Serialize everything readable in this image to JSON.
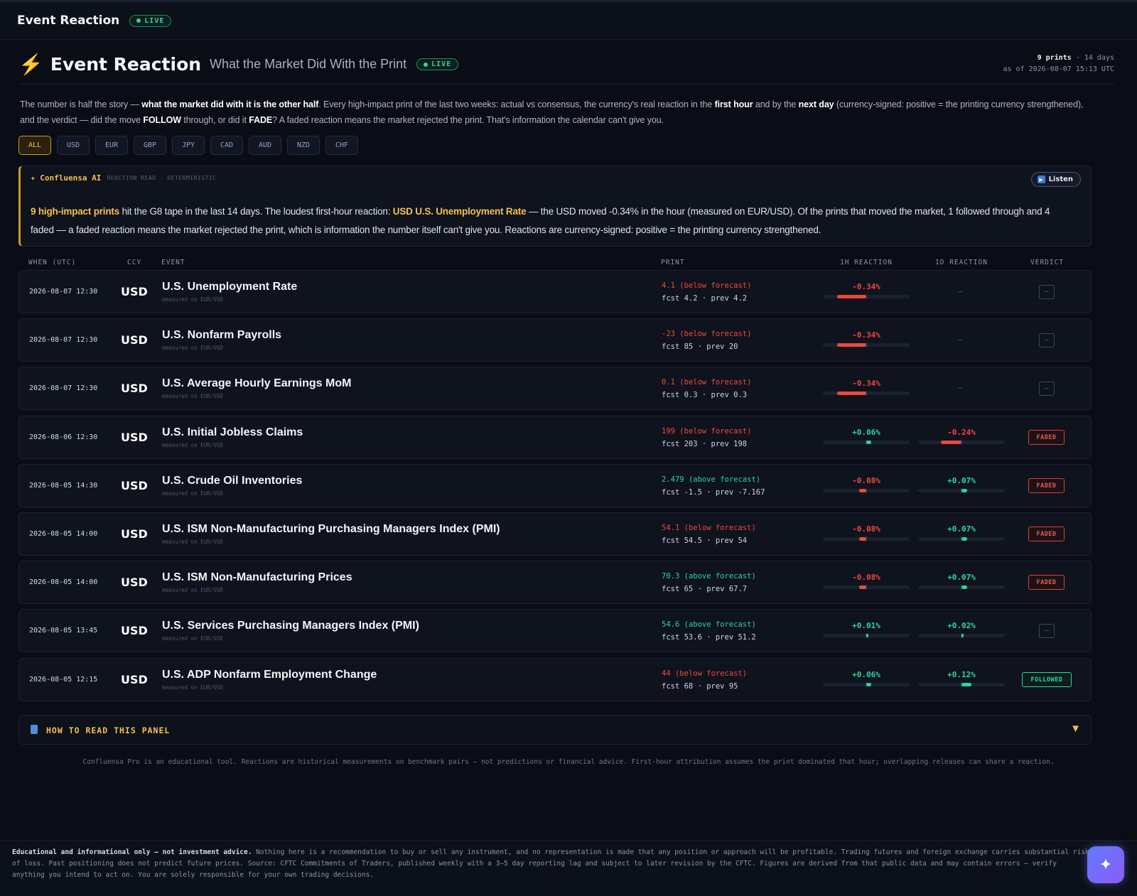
{
  "topbar": {
    "title": "Event Reaction",
    "live": "LIVE"
  },
  "header": {
    "title": "Event Reaction",
    "subtitle": "What the Market Did With the Print",
    "live": "LIVE",
    "meta_count": "9 prints",
    "meta_days": "· 14 days",
    "meta_asof": "as of 2026-08-07 15:13 UTC"
  },
  "intro": {
    "t1": "The number is half the story — ",
    "b1": "what the market did with it is the other half",
    "t2": ". Every high-impact print of the last two weeks: actual vs consensus, the currency's real reaction in the ",
    "b2": "first hour",
    "t3": " and by the ",
    "b3": "next day",
    "t4": " (currency-signed: positive = the printing currency strengthened), and the verdict — did the move ",
    "b4": "FOLLOW",
    "t5": " through, or did it ",
    "b5": "FADE",
    "t6": "? A faded reaction means the market rejected the print. That's information the calendar can't give you."
  },
  "filters": [
    "ALL",
    "USD",
    "EUR",
    "GBP",
    "JPY",
    "CAD",
    "AUD",
    "NZD",
    "CHF"
  ],
  "ai": {
    "brand": "✦ Confluensa AI",
    "tag": "REACTION READ · DETERMINISTIC",
    "listen": "Listen",
    "h1": "9 high-impact prints",
    "t1": " hit the G8 tape in the last 14 days. The loudest first-hour reaction: ",
    "h2": "USD U.S. Unemployment Rate",
    "t2": " — the USD moved -0.34% in the hour (measured on EUR/USD). Of the prints that moved the market, 1 followed through and 4 faded — a faded reaction means the market rejected the print, which is information the number itself can't give you. Reactions are currency-signed: positive = the printing currency strengthened."
  },
  "columns": {
    "when": "WHEN (UTC)",
    "ccy": "CCY",
    "event": "EVENT",
    "print": "PRINT",
    "r1h": "1H REACTION",
    "r1d": "1D REACTION",
    "verdict": "VERDICT"
  },
  "rows": [
    {
      "when": "2026-08-07 12:30",
      "ccy": "USD",
      "event": "U.S. Unemployment Rate",
      "measured": "measured on EUR/USD",
      "actual": "4.1",
      "dir": "(below forecast)",
      "dir_sign": "neg",
      "fcst": "fcst 4.2 · prev 4.2",
      "r1h": "-0.34%",
      "r1h_v": -0.34,
      "r1d": "—",
      "r1d_v": null,
      "verdict": "—",
      "verdict_type": "none"
    },
    {
      "when": "2026-08-07 12:30",
      "ccy": "USD",
      "event": "U.S. Nonfarm Payrolls",
      "measured": "measured on EUR/USD",
      "actual": "-23",
      "dir": "(below forecast)",
      "dir_sign": "neg",
      "fcst": "fcst 85 · prev 20",
      "r1h": "-0.34%",
      "r1h_v": -0.34,
      "r1d": "—",
      "r1d_v": null,
      "verdict": "—",
      "verdict_type": "none"
    },
    {
      "when": "2026-08-07 12:30",
      "ccy": "USD",
      "event": "U.S. Average Hourly Earnings MoM",
      "measured": "measured on EUR/USD",
      "actual": "0.1",
      "dir": "(below forecast)",
      "dir_sign": "neg",
      "fcst": "fcst 0.3 · prev 0.3",
      "r1h": "-0.34%",
      "r1h_v": -0.34,
      "r1d": "—",
      "r1d_v": null,
      "verdict": "—",
      "verdict_type": "none"
    },
    {
      "when": "2026-08-06 12:30",
      "ccy": "USD",
      "event": "U.S. Initial Jobless Claims",
      "measured": "measured on EUR/USD",
      "actual": "199",
      "dir": "(below forecast)",
      "dir_sign": "neg",
      "fcst": "fcst 203 · prev 198",
      "r1h": "+0.06%",
      "r1h_v": 0.06,
      "r1d": "-0.24%",
      "r1d_v": -0.24,
      "verdict": "FADED",
      "verdict_type": "faded"
    },
    {
      "when": "2026-08-05 14:30",
      "ccy": "USD",
      "event": "U.S. Crude Oil Inventories",
      "measured": "measured on EUR/USD",
      "actual": "2.479",
      "dir": "(above forecast)",
      "dir_sign": "pos",
      "fcst": "fcst -1.5 · prev -7.167",
      "r1h": "-0.08%",
      "r1h_v": -0.08,
      "r1d": "+0.07%",
      "r1d_v": 0.07,
      "verdict": "FADED",
      "verdict_type": "faded"
    },
    {
      "when": "2026-08-05 14:00",
      "ccy": "USD",
      "event": "U.S. ISM Non-Manufacturing Purchasing Managers Index (PMI)",
      "measured": "measured on EUR/USD",
      "actual": "54.1",
      "dir": "(below forecast)",
      "dir_sign": "neg",
      "fcst": "fcst 54.5 · prev 54",
      "r1h": "-0.08%",
      "r1h_v": -0.08,
      "r1d": "+0.07%",
      "r1d_v": 0.07,
      "verdict": "FADED",
      "verdict_type": "faded"
    },
    {
      "when": "2026-08-05 14:00",
      "ccy": "USD",
      "event": "U.S. ISM Non-Manufacturing Prices",
      "measured": "measured on EUR/USD",
      "actual": "70.3",
      "dir": "(above forecast)",
      "dir_sign": "pos",
      "fcst": "fcst 65 · prev 67.7",
      "r1h": "-0.08%",
      "r1h_v": -0.08,
      "r1d": "+0.07%",
      "r1d_v": 0.07,
      "verdict": "FADED",
      "verdict_type": "faded"
    },
    {
      "when": "2026-08-05 13:45",
      "ccy": "USD",
      "event": "U.S. Services Purchasing Managers Index (PMI)",
      "measured": "measured on EUR/USD",
      "actual": "54.6",
      "dir": "(above forecast)",
      "dir_sign": "pos",
      "fcst": "fcst 53.6 · prev 51.2",
      "r1h": "+0.01%",
      "r1h_v": 0.01,
      "r1d": "+0.02%",
      "r1d_v": 0.02,
      "verdict": "—",
      "verdict_type": "none"
    },
    {
      "when": "2026-08-05 12:15",
      "ccy": "USD",
      "event": "U.S. ADP Nonfarm Employment Change",
      "measured": "measured on EUR/USD",
      "actual": "44",
      "dir": "(below forecast)",
      "dir_sign": "neg",
      "fcst": "fcst 68 · prev 95",
      "r1h": "+0.06%",
      "r1h_v": 0.06,
      "r1d": "+0.12%",
      "r1d_v": 0.12,
      "verdict": "FOLLOWED",
      "verdict_type": "followed"
    }
  ],
  "howto": {
    "label": "HOW TO READ THIS PANEL"
  },
  "disclaimer": "Confluensa Pro is an educational tool. Reactions are historical measurements on benchmark pairs — not predictions or financial advice. First-hour attribution assumes the print dominated that hour; overlapping releases can share a reaction.",
  "footer": {
    "bold": "Educational and informational only — not investment advice.",
    "text": " Nothing here is a recommendation to buy or sell any instrument, and no representation is made that any position or approach will be profitable. Trading futures and foreign exchange carries substantial risk of loss. Past positioning does not predict future prices. Source: CFTC Commitments of Traders, published weekly with a 3–5 day reporting lag and subject to later revision by the CFTC. Figures are derived from that public data and may contain errors — verify anything you intend to act on. You are solely responsible for your own trading decisions."
  },
  "colors": {
    "accent": "#f5c04a",
    "negative": "#f0483c",
    "positive": "#2dd4a0",
    "background": "#0a0d16"
  },
  "icons": {
    "bolt": "lightning-icon",
    "play": "play-icon",
    "book": "book-icon",
    "chevron": "chevron-down-icon",
    "fab": "sparkle-icon"
  }
}
